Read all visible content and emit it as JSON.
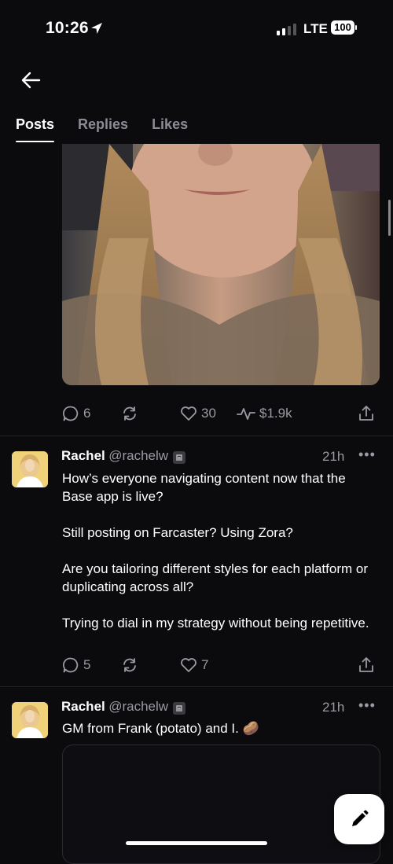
{
  "status_bar": {
    "time": "10:26",
    "network": "LTE",
    "battery": "100"
  },
  "tabs": [
    {
      "label": "Posts",
      "active": true
    },
    {
      "label": "Replies",
      "active": false
    },
    {
      "label": "Likes",
      "active": false
    }
  ],
  "post1": {
    "actions": {
      "comments": "6",
      "likes": "30",
      "earnings": "$1.9k"
    }
  },
  "post2": {
    "name": "Rachel",
    "handle": "@rachelw",
    "time": "21h",
    "paragraphs": [
      "How’s everyone navigating content now that the Base app is live?",
      "Still posting on Farcaster? Using Zora?",
      "Are you tailoring different styles for each platform or duplicating across all?",
      "Trying to dial in my strategy without being repetitive."
    ],
    "actions": {
      "comments": "5",
      "likes": "7"
    }
  },
  "post3": {
    "name": "Rachel",
    "handle": "@rachelw",
    "time": "21h",
    "text": "GM from Frank (potato) and I. 🥔"
  },
  "icons": {
    "back": "arrow-left-icon",
    "comment": "comment-icon",
    "recast": "recast-icon",
    "like": "heart-icon",
    "earnings": "pulse-icon",
    "share": "share-icon",
    "more": "more-icon",
    "compose": "pencil-icon"
  }
}
